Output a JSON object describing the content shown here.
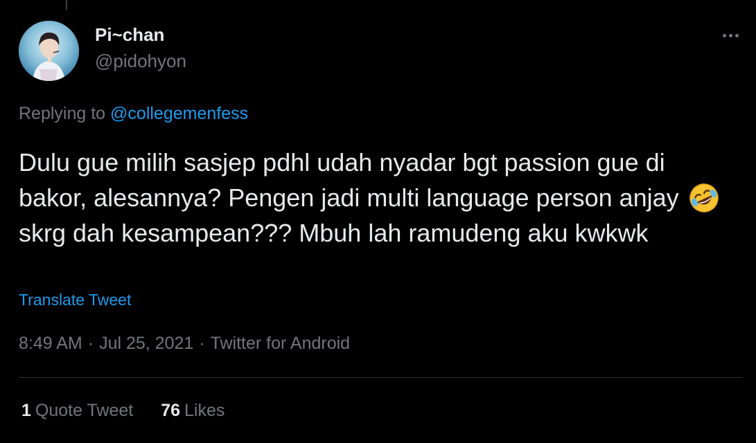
{
  "user": {
    "display_name": "Pi~chan",
    "handle": "@pidohyon"
  },
  "reply": {
    "prefix": "Replying to ",
    "target": "@collegemenfess"
  },
  "tweet": {
    "text_part1": "Dulu gue milih sasjep pdhl udah nyadar bgt passion gue di bakor, alesannya? Pengen jadi multi language person anjay",
    "emoji": "rolling-on-the-floor-laughing",
    "text_part2": "skrg dah kesampean??? Mbuh lah ramudeng aku kwkwk"
  },
  "translate_label": "Translate Tweet",
  "meta": {
    "time": "8:49 AM",
    "date": "Jul 25, 2021",
    "source": "Twitter for Android",
    "separator": "·"
  },
  "stats": {
    "quote_count": "1",
    "quote_label": "Quote Tweet",
    "likes_count": "76",
    "likes_label": "Likes"
  },
  "colors": {
    "background": "#000000",
    "text": "#e7e9ea",
    "muted": "#71767b",
    "accent": "#1d9bf0",
    "divider": "#2f3336"
  }
}
